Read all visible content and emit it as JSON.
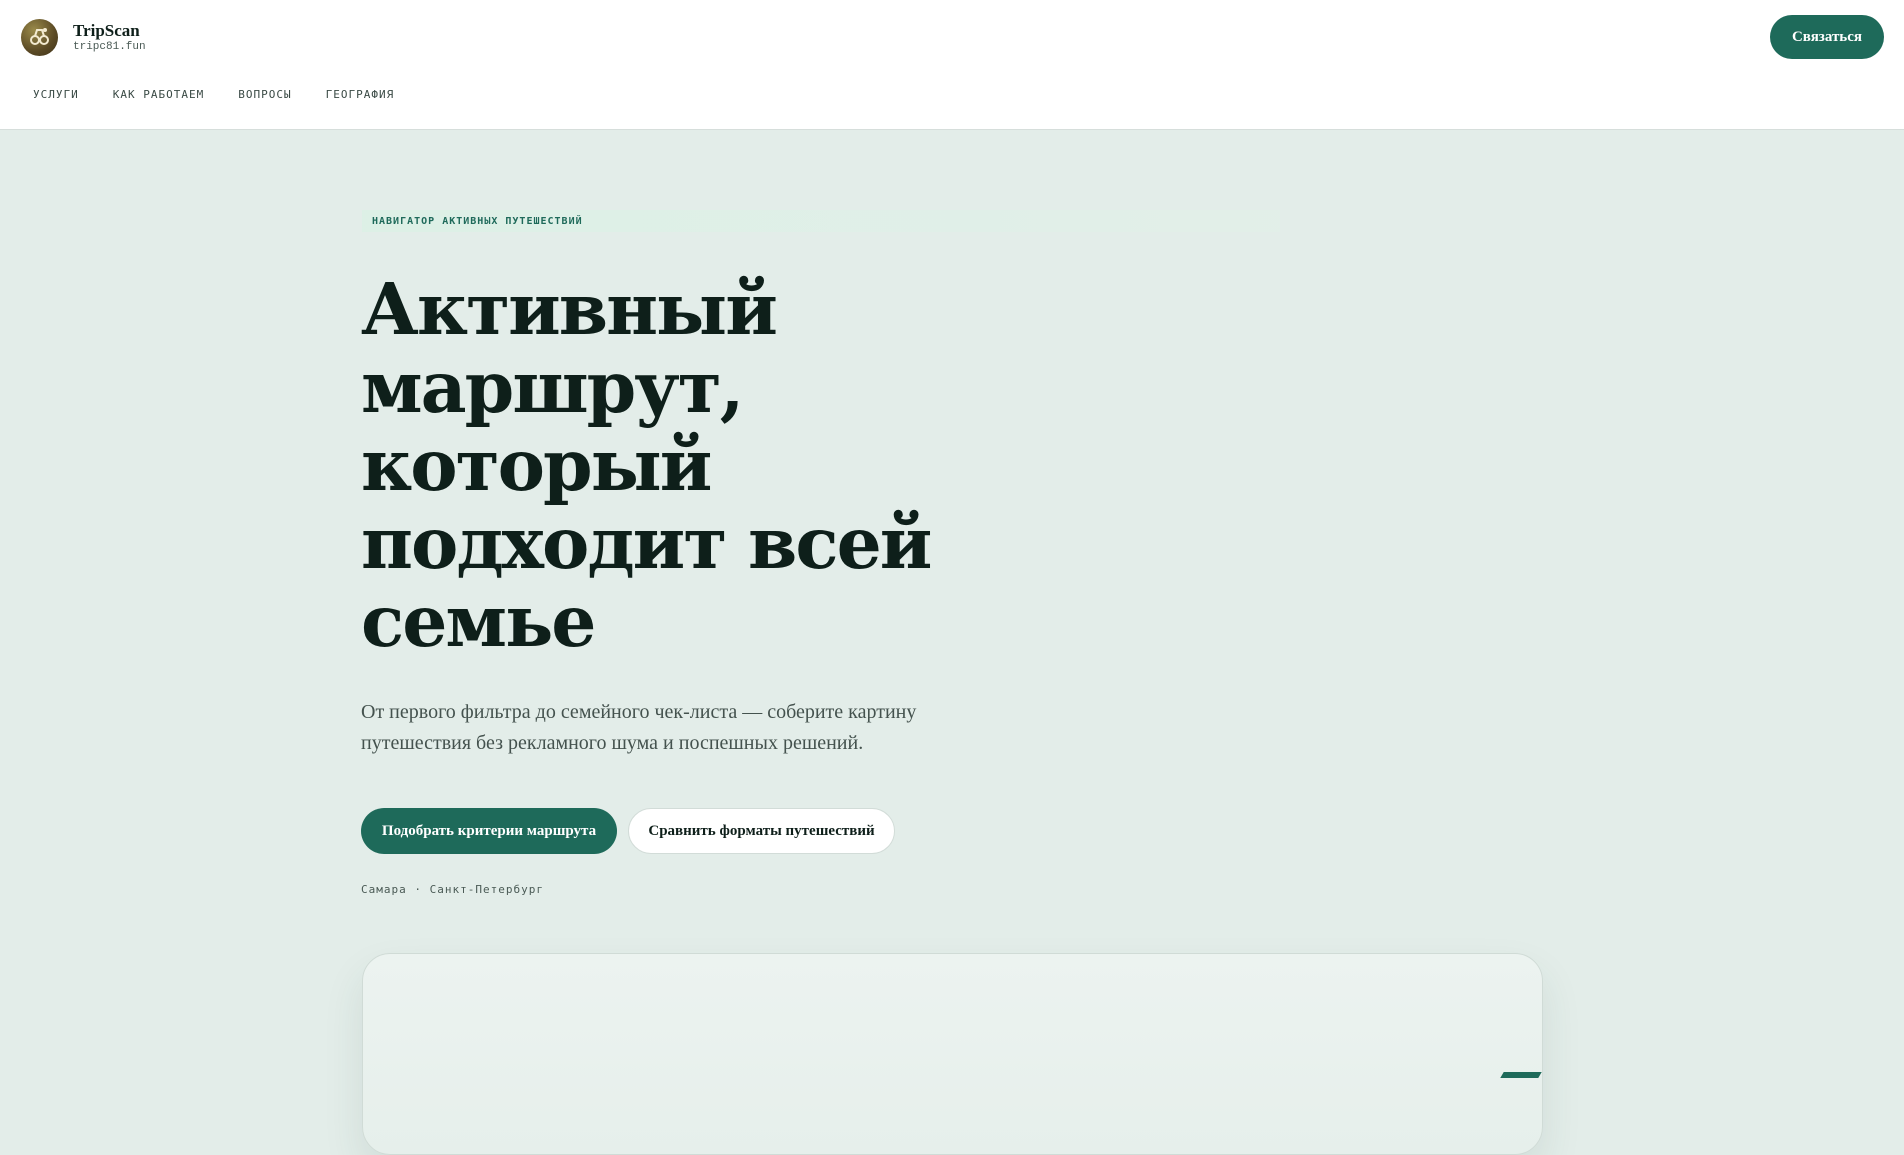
{
  "header": {
    "brand_name": "TripScan",
    "brand_domain": "tripc81.fun",
    "logo_icon": "binoculars-icon",
    "contact_label": "Связаться",
    "nav": [
      {
        "label": "УСЛУГИ"
      },
      {
        "label": "КАК РАБОТАЕМ"
      },
      {
        "label": "ВОПРОСЫ"
      },
      {
        "label": "ГЕОГРАФИЯ"
      }
    ]
  },
  "hero": {
    "eyebrow": "НАВИГАТОР АКТИВНЫХ ПУТЕШЕСТВИЙ",
    "title_lines": [
      "Активный",
      "маршрут,",
      "который",
      "подходит всей",
      "семье"
    ],
    "subtitle": "От первого фильтра до семейного чек-листа — соберите картину путешествия без рекламного шума и поспешных решений.",
    "primary_cta": "Подобрать критерии маршрута",
    "secondary_cta": "Сравнить форматы путешествий",
    "cities": "Самара · Санкт-Петербург"
  },
  "colors": {
    "accent": "#1e6a5a",
    "page_bg": "#e3ede9",
    "header_bg": "#ffffff",
    "text": "#0e1f1a"
  }
}
